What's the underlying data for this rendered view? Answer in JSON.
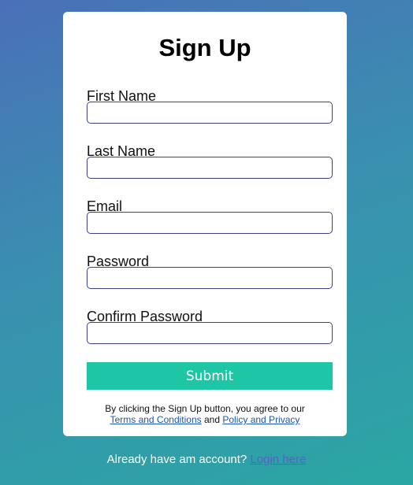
{
  "form": {
    "title": "Sign Up",
    "fields": [
      {
        "label": "First Name",
        "value": ""
      },
      {
        "label": "Last Name",
        "value": ""
      },
      {
        "label": "Email",
        "value": ""
      },
      {
        "label": "Password",
        "value": ""
      },
      {
        "label": "Confirm Password",
        "value": ""
      }
    ],
    "submit_label": "Submit",
    "terms": {
      "prefix": "By clicking the Sign Up button, you agree to our",
      "terms_link": "Terms and Conditions",
      "conjunction": "and",
      "privacy_link": "Policy and Privacy"
    }
  },
  "footer": {
    "text": "Already have am account?",
    "login_link": "Login here"
  },
  "colors": {
    "accent": "#1fc6a6",
    "input_border": "#3e3f8a",
    "link": "#1a55b0"
  }
}
